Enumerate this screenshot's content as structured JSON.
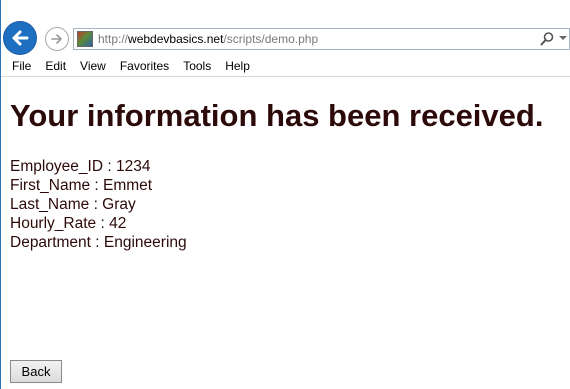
{
  "browser": {
    "url_prefix": "http://",
    "url_domain": "webdevbasics.net",
    "url_path": "/scripts/demo.php",
    "accent_color": "#1f6fc1",
    "back_icon": "back-arrow-icon",
    "forward_icon": "forward-arrow-icon",
    "search_icon": "search-icon"
  },
  "menu": {
    "items": [
      "File",
      "Edit",
      "View",
      "Favorites",
      "Tools",
      "Help"
    ]
  },
  "page": {
    "heading": "Your information has been received.",
    "text_color": "#2d0a0a",
    "fields": [
      {
        "label": "Employee_ID",
        "value": "1234"
      },
      {
        "label": "First_Name",
        "value": "Emmet"
      },
      {
        "label": "Last_Name",
        "value": "Gray"
      },
      {
        "label": "Hourly_Rate",
        "value": "42"
      },
      {
        "label": "Department",
        "value": "Engineering"
      }
    ],
    "lines": [
      "Employee_ID : 1234",
      "First_Name : Emmet",
      "Last_Name : Gray",
      "Hourly_Rate : 42",
      "Department : Engineering"
    ],
    "back_button_label": "Back"
  }
}
